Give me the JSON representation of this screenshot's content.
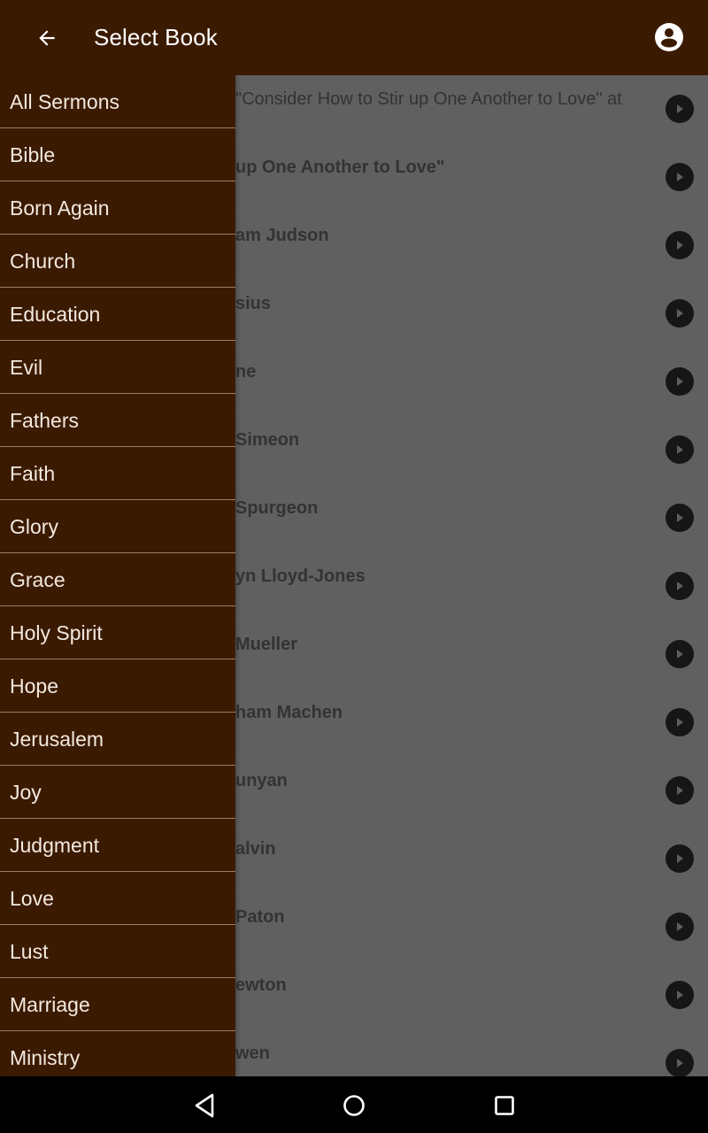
{
  "appbar": {
    "title": "Select Book",
    "back_icon": "arrow-left-icon",
    "account_icon": "account-circle-icon"
  },
  "colors": {
    "primary": "#3b1a02",
    "drawer_text": "#f3e9df",
    "divider": "#a07c62",
    "scrim_bg": "#606060"
  },
  "drawer": {
    "items": [
      {
        "label": "All Sermons"
      },
      {
        "label": "Bible"
      },
      {
        "label": "Born Again"
      },
      {
        "label": "Church"
      },
      {
        "label": "Education"
      },
      {
        "label": "Evil"
      },
      {
        "label": "Fathers"
      },
      {
        "label": "Faith"
      },
      {
        "label": "Glory"
      },
      {
        "label": "Grace"
      },
      {
        "label": "Holy Spirit"
      },
      {
        "label": "Hope"
      },
      {
        "label": "Jerusalem"
      },
      {
        "label": "Joy"
      },
      {
        "label": "Judgment"
      },
      {
        "label": "Love"
      },
      {
        "label": "Lust"
      },
      {
        "label": "Marriage"
      },
      {
        "label": "Ministry"
      }
    ]
  },
  "list": {
    "rows": [
      {
        "text": "\"Consider How to Stir up One Another to Love\" at",
        "bold": false,
        "visible_text_start": "\"Consider"
      },
      {
        "text": "up One Another to Love\"",
        "bold": true
      },
      {
        "text": "am Judson",
        "bold": true
      },
      {
        "text": "sius",
        "bold": true
      },
      {
        "text": "ne",
        "bold": true
      },
      {
        "text": " Simeon",
        "bold": true
      },
      {
        "text": " Spurgeon",
        "bold": true
      },
      {
        "text": "yn Lloyd-Jones",
        "bold": true
      },
      {
        "text": "Mueller",
        "bold": true
      },
      {
        "text": "ham Machen",
        "bold": true
      },
      {
        "text": "unyan",
        "bold": true
      },
      {
        "text": "alvin",
        "bold": true
      },
      {
        "text": " Paton",
        "bold": true
      },
      {
        "text": "ewton",
        "bold": true
      },
      {
        "text": "wen",
        "bold": true
      }
    ],
    "play_icon": "play-circle-icon"
  },
  "navbar": {
    "back_icon": "nav-back-icon",
    "home_icon": "nav-home-icon",
    "recents_icon": "nav-recents-icon"
  }
}
